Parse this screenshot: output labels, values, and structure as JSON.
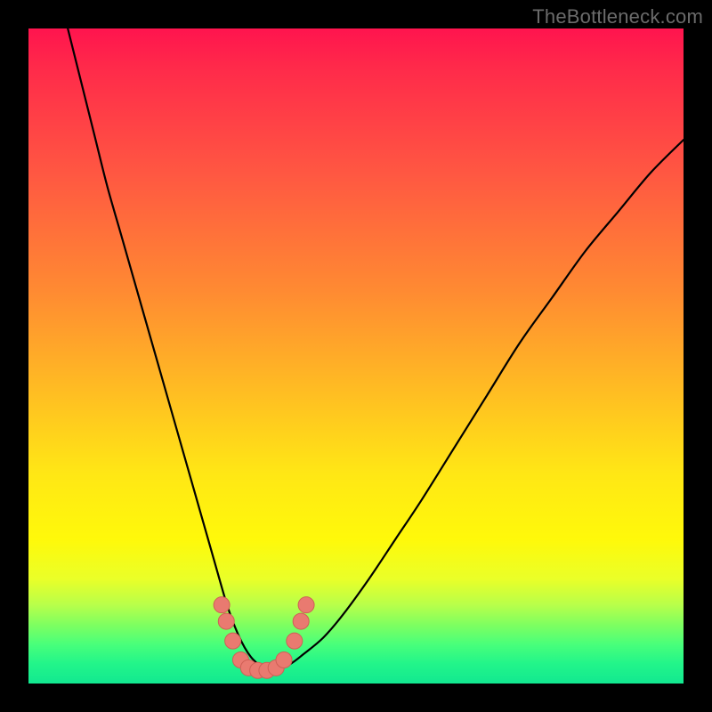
{
  "watermark": {
    "text": "TheBottleneck.com"
  },
  "colors": {
    "curve_stroke": "#000000",
    "marker_fill": "#e97a70",
    "marker_stroke": "#cf5f55"
  },
  "chart_data": {
    "type": "line",
    "title": "",
    "xlabel": "",
    "ylabel": "",
    "xlim": [
      0,
      100
    ],
    "ylim": [
      0,
      100
    ],
    "series": [
      {
        "name": "curve",
        "x": [
          6,
          8,
          10,
          12,
          14,
          16,
          18,
          20,
          22,
          24,
          26,
          28,
          30,
          31,
          32,
          33,
          34,
          35,
          36,
          37,
          38,
          40,
          42,
          45,
          48,
          52,
          56,
          60,
          65,
          70,
          75,
          80,
          85,
          90,
          95,
          100
        ],
        "y": [
          100,
          92,
          84,
          76,
          69,
          62,
          55,
          48,
          41,
          34,
          27,
          20,
          13,
          10,
          7.5,
          5.5,
          4,
          3,
          2.2,
          2,
          2.2,
          3,
          4.5,
          7,
          10.5,
          16,
          22,
          28,
          36,
          44,
          52,
          59,
          66,
          72,
          78,
          83
        ]
      }
    ],
    "markers": [
      {
        "x": 29.5,
        "y": 12
      },
      {
        "x": 30.2,
        "y": 9.5
      },
      {
        "x": 31.2,
        "y": 6.5
      },
      {
        "x": 32.4,
        "y": 3.6
      },
      {
        "x": 33.6,
        "y": 2.4
      },
      {
        "x": 35.0,
        "y": 2.0
      },
      {
        "x": 36.4,
        "y": 2.0
      },
      {
        "x": 37.8,
        "y": 2.4
      },
      {
        "x": 39.0,
        "y": 3.6
      },
      {
        "x": 40.6,
        "y": 6.5
      },
      {
        "x": 41.6,
        "y": 9.5
      },
      {
        "x": 42.4,
        "y": 12
      }
    ]
  }
}
